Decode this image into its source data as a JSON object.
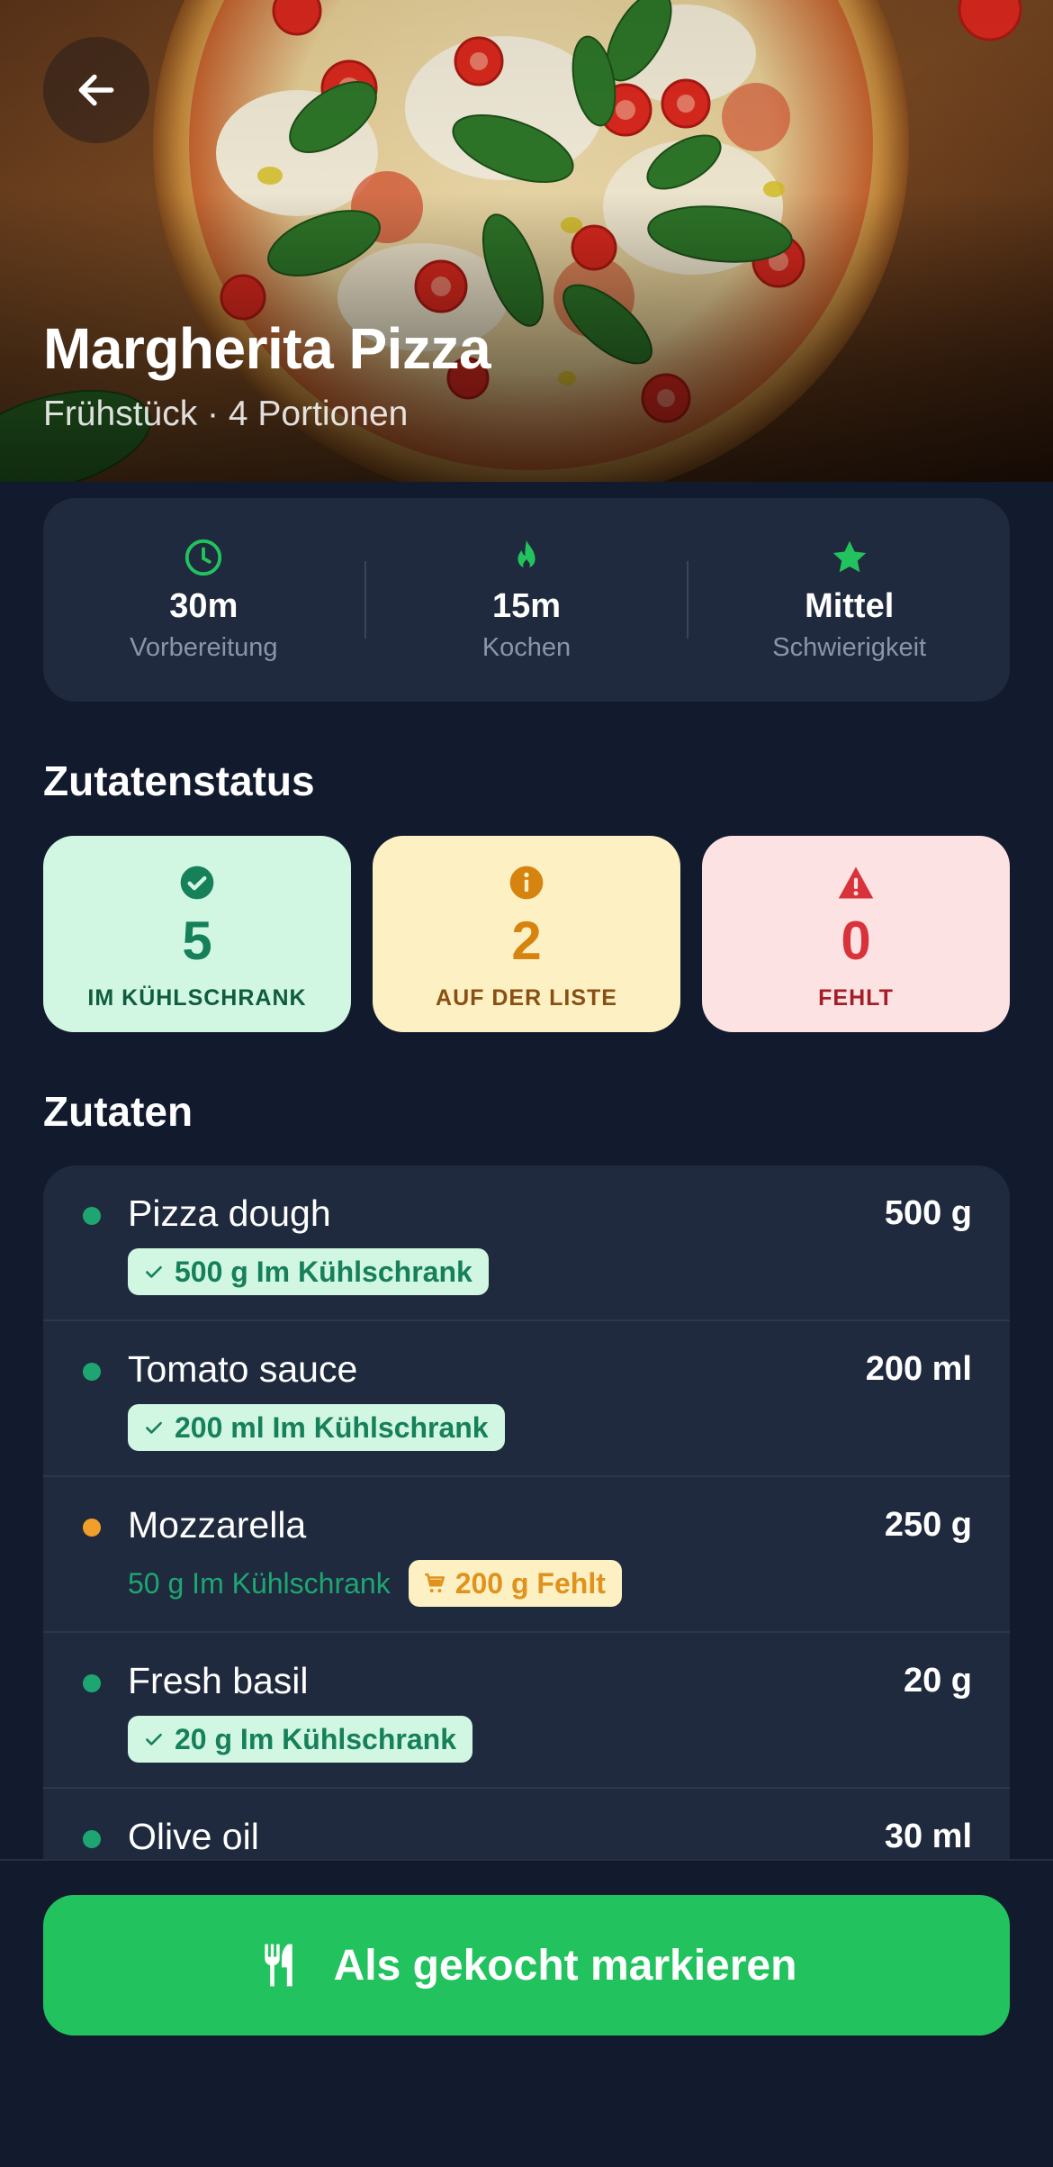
{
  "header": {
    "title": "Margherita Pizza",
    "subtitle": "Frühstück · 4 Portionen"
  },
  "stats": [
    {
      "icon": "clock-icon",
      "value": "30m",
      "label": "Vorbereitung"
    },
    {
      "icon": "flame-icon",
      "value": "15m",
      "label": "Kochen"
    },
    {
      "icon": "star-icon",
      "value": "Mittel",
      "label": "Schwierigkeit"
    }
  ],
  "ingredient_status": {
    "title": "Zutatenstatus",
    "cards": [
      {
        "icon": "check-circle-icon",
        "count": "5",
        "label": "IM KÜHLSCHRANK"
      },
      {
        "icon": "info-icon",
        "count": "2",
        "label": "AUF DER LISTE"
      },
      {
        "icon": "warning-icon",
        "count": "0",
        "label": "FEHLT"
      }
    ]
  },
  "ingredients": {
    "title": "Zutaten",
    "items": [
      {
        "name": "Pizza dough",
        "qty": "500 g",
        "dot": "#1ea672",
        "tag": "500 g Im Kühlschrank"
      },
      {
        "name": "Tomato sauce",
        "qty": "200 ml",
        "dot": "#1ea672",
        "tag": "200 ml Im Kühlschrank"
      },
      {
        "name": "Mozzarella",
        "qty": "250 g",
        "dot": "#f0a02a",
        "have": "50 g Im Kühlschrank",
        "missing": "200 g Fehlt"
      },
      {
        "name": "Fresh basil",
        "qty": "20 g",
        "dot": "#1ea672",
        "tag": "20 g Im Kühlschrank"
      },
      {
        "name": "Olive oil",
        "qty": "30 ml",
        "dot": "#1ea672"
      }
    ]
  },
  "action": {
    "label": "Als gekocht markieren",
    "icon": "utensils-icon"
  },
  "colors": {
    "background": "#121a2e",
    "card": "#1f2a3e",
    "accent_green": "#22c35e",
    "status_green": "#16805a",
    "status_yellow": "#d68310",
    "status_red": "#d8323a"
  }
}
